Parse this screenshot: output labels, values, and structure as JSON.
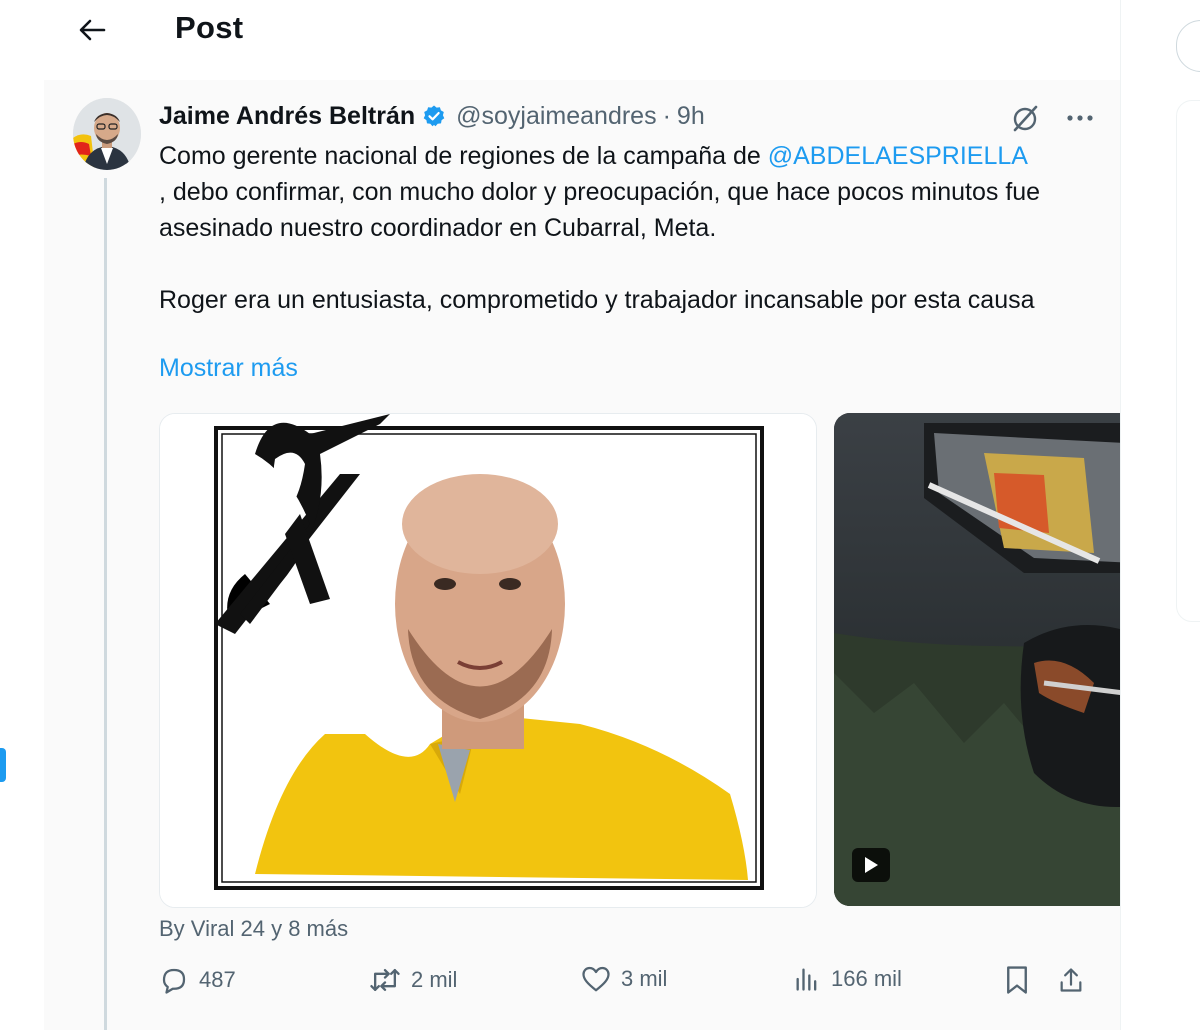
{
  "header": {
    "title": "Post",
    "back_icon": "arrow-left-icon"
  },
  "tweet": {
    "author": {
      "display_name": "Jaime Andrés Beltrán",
      "handle": "@soyjaimeandres",
      "separator": "·",
      "time": "9h",
      "verified_color": "#1d9bf0"
    },
    "text": {
      "line1_pre": "Como gerente nacional de regiones de la campaña de ",
      "mention": "@ABDELAESPRIELLA",
      "line1_post": ", debo confirmar, con mucho dolor y preocupación, que hace pocos minutos fue asesinado nuestro coordinador en Cubarral, Meta.",
      "paragraph2": "Roger era un entusiasta, comprometido y trabajador incansable por esta causa"
    },
    "show_more": "Mostrar más",
    "media": [
      {
        "type": "photo",
        "description_icon": "mourning-ribbon-icon"
      },
      {
        "type": "video",
        "play_icon": "play-icon"
      }
    ],
    "attribution": "By Viral 24 y 8 más",
    "stats": {
      "replies": "487",
      "reposts": "2 mil",
      "likes": "3 mil",
      "views": "166 mil"
    }
  },
  "colors": {
    "accent": "#1d9bf0",
    "text_primary": "#0f1419",
    "text_secondary": "#536471"
  }
}
